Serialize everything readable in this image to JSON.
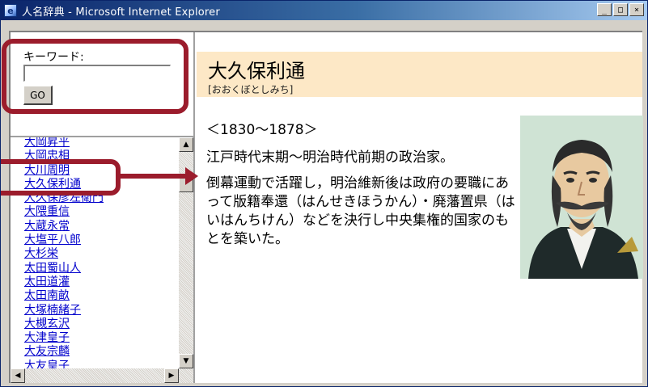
{
  "window": {
    "title": "人名辞典 - Microsoft Internet Explorer",
    "controls": [
      "_",
      "□",
      "×"
    ]
  },
  "search": {
    "label": "キーワード:",
    "placeholder": "",
    "value": "",
    "button_label": "GO"
  },
  "list": {
    "items": [
      "大岡昇平",
      "大岡忠相",
      "大川周明",
      "大久保利通",
      "大久保彦左衛門",
      "大隈重信",
      "大蔵永常",
      "大塩平八郎",
      "大杉栄",
      "太田蜀山人",
      "太田道灌",
      "太田南畝",
      "大塚楠緒子",
      "大槻玄沢",
      "大津皇子",
      "大友宗麟",
      "大友皇子"
    ],
    "selected_index": 3
  },
  "entry": {
    "name": "大久保利通",
    "reading": "[おおくぼとしみち]",
    "years": "＜1830〜1878＞",
    "era": "江戸時代末期〜明治時代前期の政治家。",
    "description": "倒幕運動で活躍し，明治維新後は政府の要職にあって版籍奉還（はんせきほうかん）・廃藩置県（はいはんちけん）などを決行し中央集権的国家のもとを築いた。"
  },
  "colors": {
    "highlight": "#9b1c2c",
    "link": "#0000cc",
    "header_bg": "#fde8c6"
  }
}
